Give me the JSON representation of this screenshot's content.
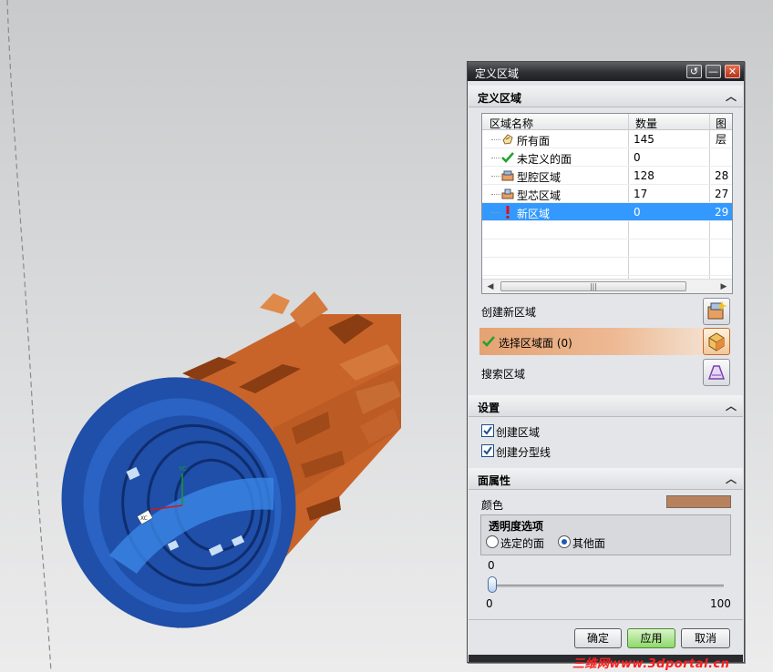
{
  "dialog": {
    "title": "定义区域",
    "title_buttons": [
      "reset-icon",
      "minimize-icon",
      "close-icon"
    ]
  },
  "section_define": {
    "header": "定义区域",
    "table": {
      "columns": [
        "区域名称",
        "数量",
        "图层"
      ],
      "rows": [
        {
          "icon": "all-faces-icon",
          "name": "所有面",
          "count": "145",
          "layer": ""
        },
        {
          "icon": "green-check-icon",
          "name": "未定义的面",
          "count": "0",
          "layer": ""
        },
        {
          "icon": "cavity-region-icon",
          "name": "型腔区域",
          "count": "128",
          "layer": "28"
        },
        {
          "icon": "core-region-icon",
          "name": "型芯区域",
          "count": "17",
          "layer": "27"
        },
        {
          "icon": "warning-exclamation-icon",
          "name": "新区域",
          "count": "0",
          "layer": "29",
          "selected": true
        }
      ]
    },
    "create_region_label": "创建新区域",
    "select_faces_label": "选择区域面 (0)",
    "search_region_label": "搜索区域"
  },
  "section_settings": {
    "header": "设置",
    "options": [
      {
        "label": "创建区域",
        "checked": true
      },
      {
        "label": "创建分型线",
        "checked": true
      }
    ]
  },
  "section_face_props": {
    "header": "面属性",
    "color_label": "颜色",
    "color_value": "#b8815d",
    "transparency": {
      "legend": "透明度选项",
      "options": [
        {
          "label": "选定的面",
          "selected": false
        },
        {
          "label": "其他面",
          "selected": true
        }
      ],
      "value": 0,
      "min_label": "0",
      "max_label": "100",
      "value_label": "0"
    }
  },
  "buttons": {
    "ok": "确定",
    "apply": "应用",
    "cancel": "取消"
  },
  "model": {
    "axis_label_y": "YC",
    "axis_label_x": "XC"
  },
  "watermark": "三维网www.3dportal.cn",
  "colors": {
    "orange_body": "#c8642a",
    "blue_face": "#1f4fa8",
    "selection": "#3399ff"
  }
}
